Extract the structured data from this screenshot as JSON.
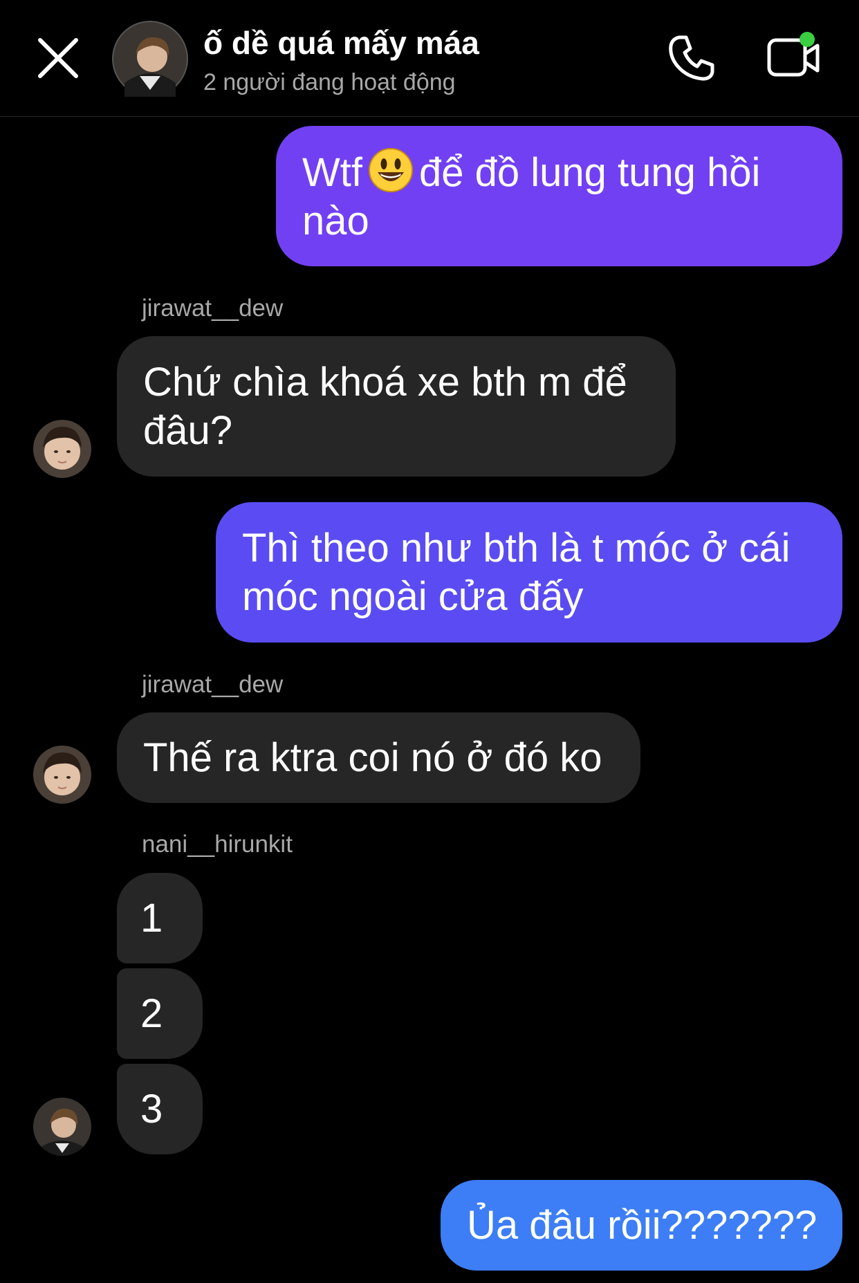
{
  "header": {
    "title": "ố dề quá mấy máa",
    "subtitle": "2 người đang hoạt động",
    "close_icon": "close-icon",
    "call_icon": "phone-icon",
    "video_icon": "video-camera-icon"
  },
  "colors": {
    "background": "#000000",
    "incoming_bubble": "#262626",
    "outgoing_gradient_top": "#7b3ff2",
    "outgoing_gradient_bottom": "#3f7cf6",
    "muted_text": "#a8a8a8",
    "online": "#3acf41"
  },
  "messages": [
    {
      "direction": "outgoing",
      "line1_before_emoji": "Wtf",
      "emoji": "smiling-face-emoji",
      "line1_after_emoji": "để đồ lung tung hồi",
      "line2": "nào"
    },
    {
      "direction": "incoming",
      "sender": "jirawat__dew",
      "line1": "Chứ chìa khoá xe bth m để",
      "line2": "đâu?"
    },
    {
      "direction": "outgoing",
      "line1": "Thì theo như bth là t móc ở cái",
      "line2": "móc ngoài cửa đấy"
    },
    {
      "direction": "incoming",
      "sender": "jirawat__dew",
      "line1": "Thế ra ktra coi nó ở đó ko"
    },
    {
      "direction": "incoming",
      "sender": "nani__hirunkit",
      "line1": "1"
    },
    {
      "direction": "incoming",
      "line1": "2"
    },
    {
      "direction": "incoming",
      "line1": "3"
    },
    {
      "direction": "outgoing",
      "line1": "Ủa đâu rồii???????"
    }
  ]
}
